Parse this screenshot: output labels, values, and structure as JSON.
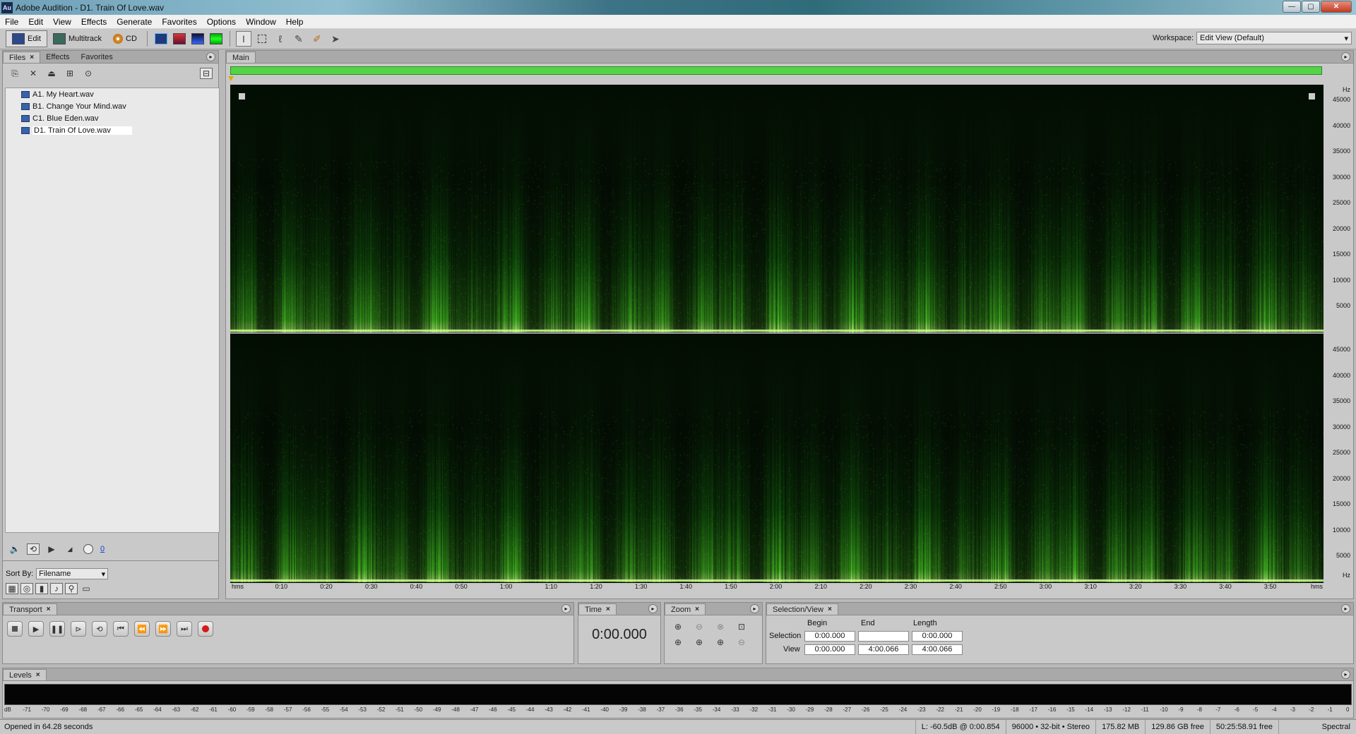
{
  "window": {
    "title": "Adobe Audition - D1. Train Of Love.wav",
    "app_icon": "Au",
    "controls": [
      "—",
      "▢",
      "✕"
    ]
  },
  "menu": [
    "File",
    "Edit",
    "View",
    "Effects",
    "Generate",
    "Favorites",
    "Options",
    "Window",
    "Help"
  ],
  "toolbar": {
    "views": [
      {
        "label": "Edit",
        "icon": "edit-view-icon"
      },
      {
        "label": "Multitrack",
        "icon": "multitrack-view-icon"
      },
      {
        "label": "CD",
        "icon": "cd-view-icon"
      }
    ],
    "workspace_label": "Workspace:",
    "workspace_value": "Edit View (Default)"
  },
  "left_panel": {
    "tabs": [
      "Files",
      "Effects",
      "Favorites"
    ],
    "files": [
      "A1. My Heart.wav",
      "B1. Change Your Mind.wav",
      "C1. Blue Eden.wav",
      "D1. Train Of Love.wav"
    ],
    "selected_index": 3,
    "volume_value": "0",
    "sort_label": "Sort By:",
    "sort_value": "Filename"
  },
  "main_panel": {
    "tab": "Main",
    "hz_unit": "Hz",
    "hz_labels": [
      "45000",
      "40000",
      "35000",
      "30000",
      "25000",
      "20000",
      "15000",
      "10000",
      "5000"
    ],
    "time_unit": "hms",
    "time_labels": [
      "0:10",
      "0:20",
      "0:30",
      "0:40",
      "0:50",
      "1:00",
      "1:10",
      "1:20",
      "1:30",
      "1:40",
      "1:50",
      "2:00",
      "2:10",
      "2:20",
      "2:30",
      "2:40",
      "2:50",
      "3:00",
      "3:10",
      "3:20",
      "3:30",
      "3:40",
      "3:50"
    ],
    "spectrogram_color": "#4cff3a"
  },
  "transport": {
    "tab": "Transport"
  },
  "time_panel": {
    "tab": "Time",
    "value": "0:00.000"
  },
  "zoom_panel": {
    "tab": "Zoom"
  },
  "selection_panel": {
    "tab": "Selection/View",
    "headers": [
      "Begin",
      "End",
      "Length"
    ],
    "selection_label": "Selection",
    "view_label": "View",
    "selection": {
      "begin": "0:00.000",
      "end": "",
      "length": "0:00.000"
    },
    "view": {
      "begin": "0:00.000",
      "end": "4:00.066",
      "length": "4:00.066"
    }
  },
  "levels": {
    "tab": "Levels",
    "scale": [
      "dB",
      "-71",
      "-70",
      "-69",
      "-68",
      "-67",
      "-66",
      "-65",
      "-64",
      "-63",
      "-62",
      "-61",
      "-60",
      "-59",
      "-58",
      "-57",
      "-56",
      "-55",
      "-54",
      "-53",
      "-52",
      "-51",
      "-50",
      "-49",
      "-48",
      "-47",
      "-46",
      "-45",
      "-44",
      "-43",
      "-42",
      "-41",
      "-40",
      "-39",
      "-38",
      "-37",
      "-36",
      "-35",
      "-34",
      "-33",
      "-32",
      "-31",
      "-30",
      "-29",
      "-28",
      "-27",
      "-26",
      "-25",
      "-24",
      "-23",
      "-22",
      "-21",
      "-20",
      "-19",
      "-18",
      "-17",
      "-16",
      "-15",
      "-14",
      "-13",
      "-12",
      "-11",
      "-10",
      "-9",
      "-8",
      "-7",
      "-6",
      "-5",
      "-4",
      "-3",
      "-2",
      "-1",
      "0"
    ]
  },
  "status": {
    "left": "Opened in 64.28 seconds",
    "cursor": "L: -60.5dB @  0:00.854",
    "format": "96000 • 32-bit • Stereo",
    "size": "175.82 MB",
    "free": "129.86 GB free",
    "time_free": "50:25:58.91 free",
    "display_mode": "Spectral Frequency"
  }
}
